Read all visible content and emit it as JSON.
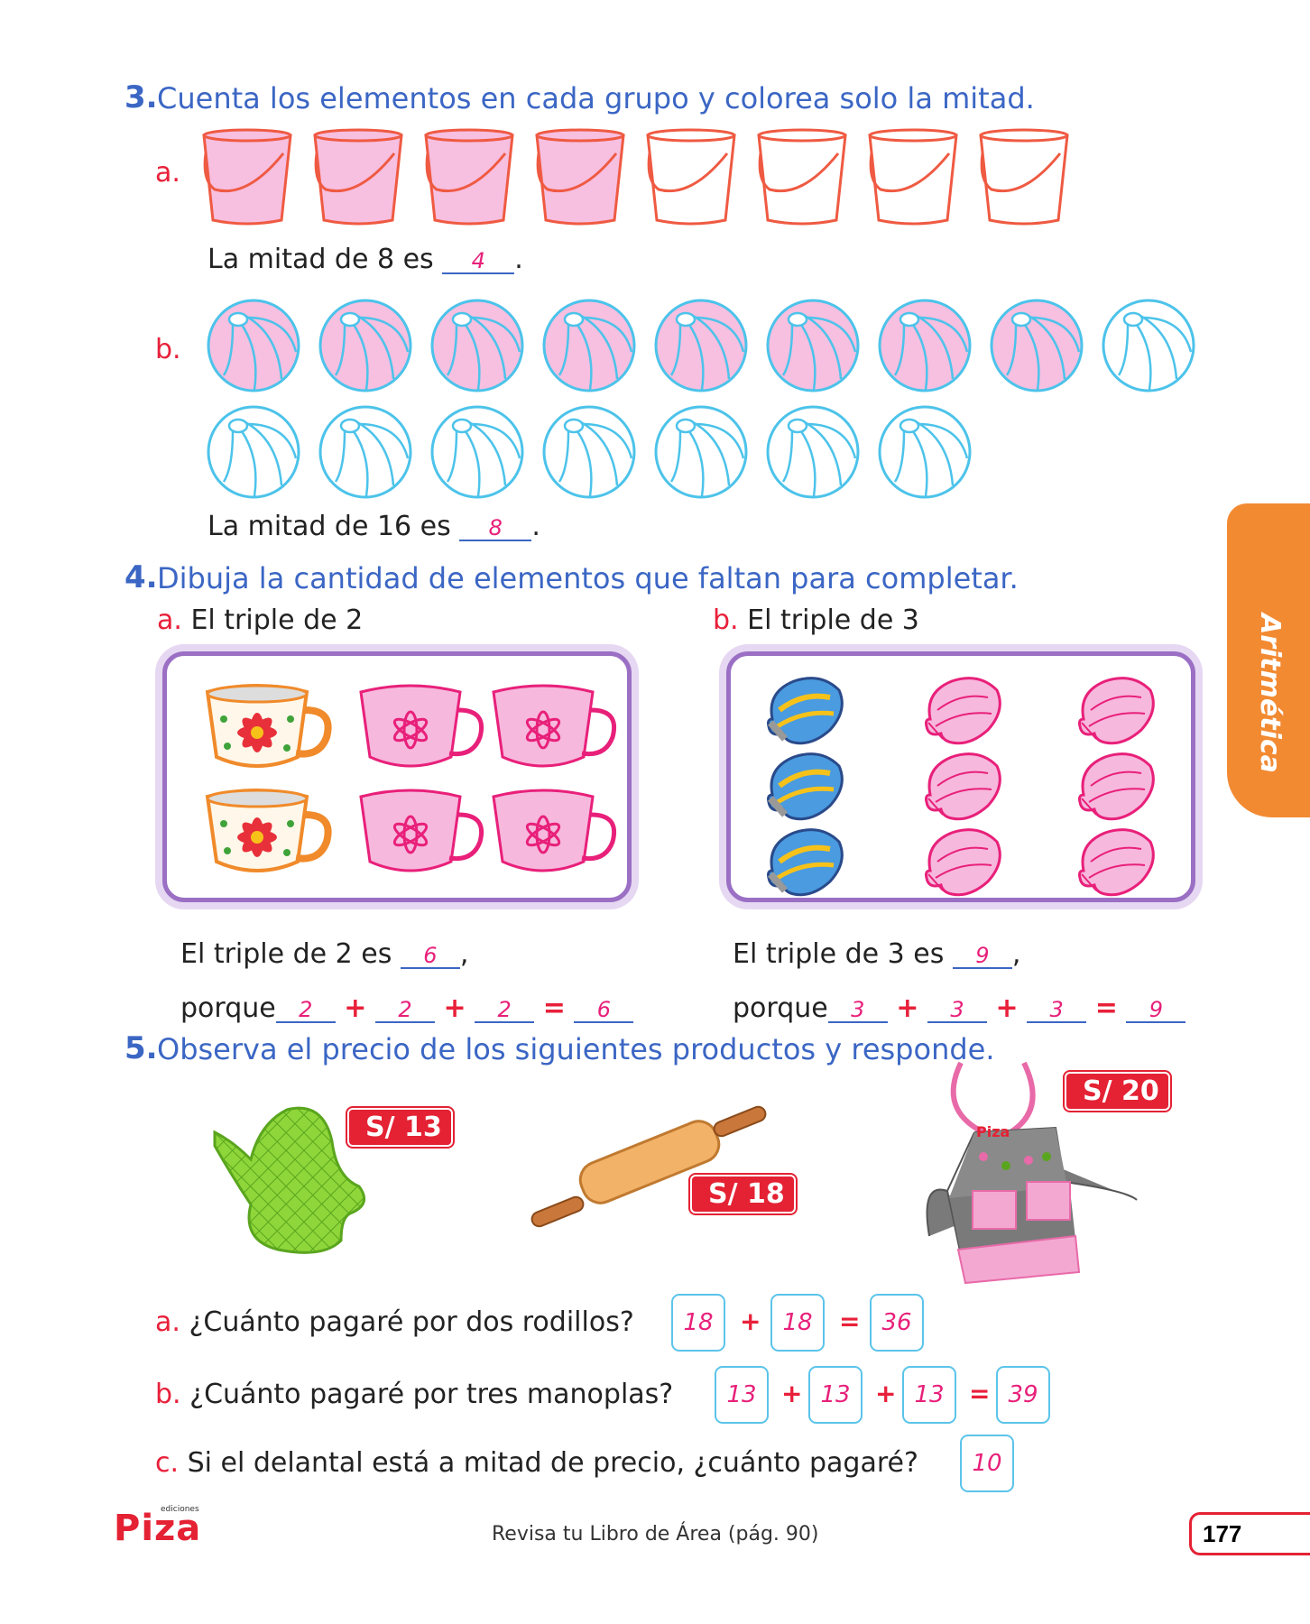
{
  "q3": {
    "num": "3.",
    "text": "Cuenta los elementos en cada grupo y colorea solo la mitad.",
    "a": {
      "label": "a.",
      "pre": "La mitad de 8 es",
      "answer": "4",
      "post": ".",
      "total": 8,
      "colored": 4
    },
    "b": {
      "label": "b.",
      "pre": "La mitad de 16 es",
      "answer": "8",
      "post": ".",
      "total": 16,
      "colored": 8
    }
  },
  "q4": {
    "num": "4.",
    "text": "Dibuja la cantidad de elementos que faltan para completar.",
    "a": {
      "label": "a.",
      "title": "El triple de 2",
      "line1_pre": "El triple de 2 es",
      "line1_answer": "6",
      "line1_post": ",",
      "porque": "porque",
      "terms": [
        "2",
        "2",
        "2"
      ],
      "result": "6"
    },
    "b": {
      "label": "b.",
      "title": "El triple de 3",
      "line1_pre": "El triple de 3 es",
      "line1_answer": "9",
      "line1_post": ",",
      "porque": "porque",
      "terms": [
        "3",
        "3",
        "3"
      ],
      "result": "9"
    },
    "plus": "+",
    "equals": "="
  },
  "q5": {
    "num": "5.",
    "text": "Observa el precio de los siguientes productos y responde.",
    "prices": {
      "mitt": "S/ 13",
      "pin": "S/ 18",
      "apron": "S/ 20"
    },
    "apron_logo": "Piza",
    "a": {
      "label": "a.",
      "text": "¿Cuánto pagaré por dos rodillos?",
      "boxes": [
        "18",
        "18",
        "36"
      ]
    },
    "b": {
      "label": "b.",
      "text": "¿Cuánto pagaré por tres manoplas?",
      "boxes": [
        "13",
        "13",
        "13",
        "39"
      ]
    },
    "c": {
      "label": "c.",
      "text": "Si el delantal está a mitad de precio, ¿cuánto pagaré?",
      "boxes": [
        "10"
      ]
    },
    "plus": "+",
    "equals": "="
  },
  "side_tab": "Aritmética",
  "footer": {
    "logo": "Piza",
    "logo_small": "ediciones",
    "note": "Revisa tu Libro de Área (pág. 90)",
    "page": "177"
  },
  "colors": {
    "blue": "#3b66c4",
    "red": "#e8203a",
    "pink": "#f7bfe0",
    "orange": "#f28a32"
  }
}
